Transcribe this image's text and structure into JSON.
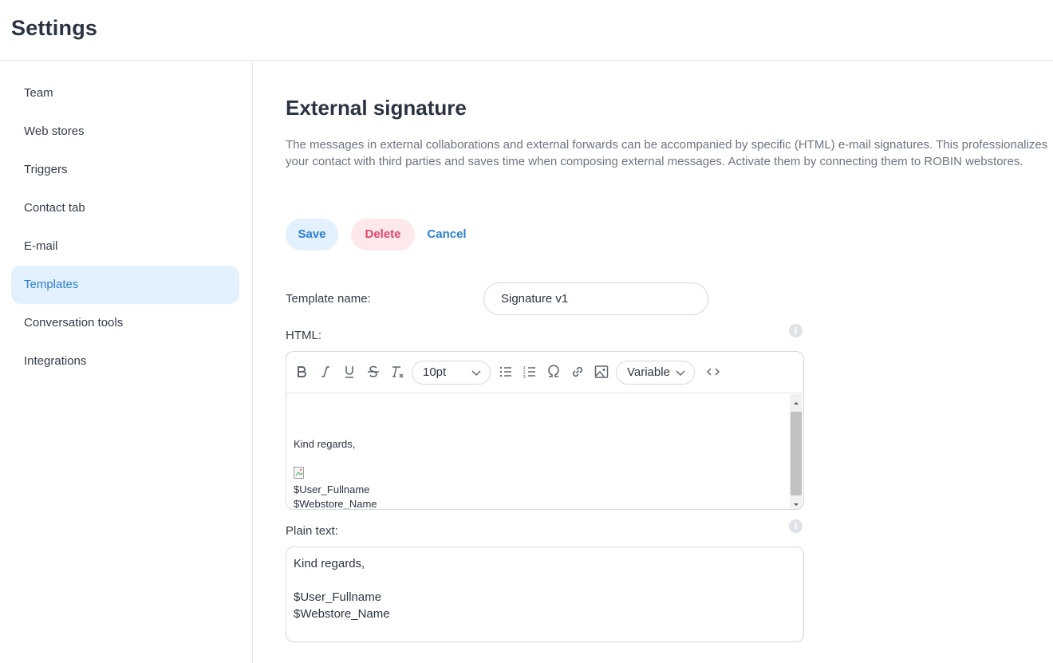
{
  "header": {
    "title": "Settings"
  },
  "sidebar": {
    "items": [
      {
        "label": "Team",
        "active": false
      },
      {
        "label": "Web stores",
        "active": false
      },
      {
        "label": "Triggers",
        "active": false
      },
      {
        "label": "Contact tab",
        "active": false
      },
      {
        "label": "E-mail",
        "active": false
      },
      {
        "label": "Templates",
        "active": true
      },
      {
        "label": "Conversation tools",
        "active": false
      },
      {
        "label": "Integrations",
        "active": false
      }
    ]
  },
  "main": {
    "title": "External signature",
    "description": "The messages in external collaborations and external forwards can be accompanied by specific (HTML) e-mail signatures. This professionalizes your contact with third parties and saves time when composing external messages. Activate them by connecting them to ROBIN webstores.",
    "actions": {
      "save_label": "Save",
      "delete_label": "Delete",
      "cancel_label": "Cancel"
    },
    "template_name": {
      "label": "Template name:",
      "value": "Signature v1"
    },
    "html_editor": {
      "label": "HTML:",
      "info_icon": "i",
      "font_size": "10pt",
      "variable_label": "Variable",
      "content": {
        "line1": "Kind regards,",
        "line2": "$User_Fullname",
        "line3": "$Webstore_Name"
      }
    },
    "plain_text": {
      "label": "Plain text:",
      "info_icon": "i",
      "value": "Kind regards,\n\n$User_Fullname\n$Webstore_Name"
    }
  },
  "colors": {
    "accent": "#2a7fd5",
    "active_bg": "#e3f1fe",
    "delete": "#e1486a",
    "delete_bg": "#fde8ec",
    "border": "#d5d9de"
  }
}
